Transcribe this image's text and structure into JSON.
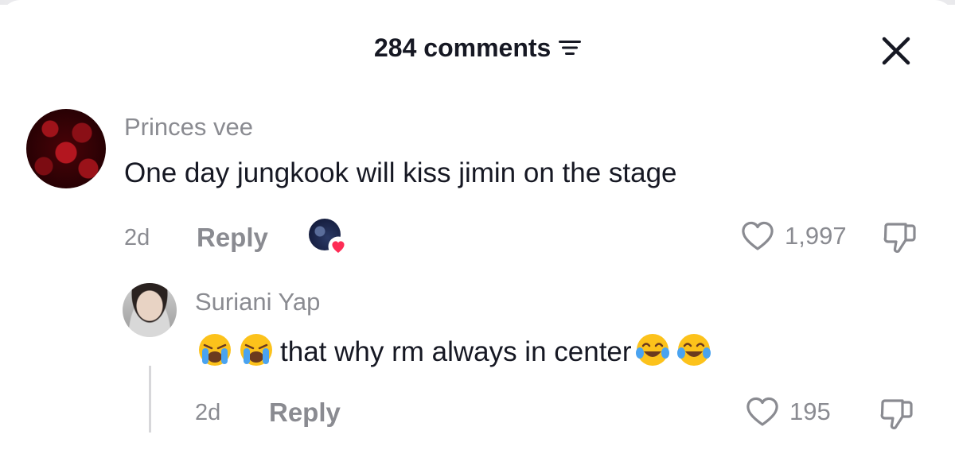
{
  "header": {
    "comment_count_label": "284 comments"
  },
  "comments": [
    {
      "username": "Princes vee",
      "text": "One day jungkook will kiss jimin on the stage",
      "age": "2d",
      "reply_label": "Reply",
      "like_count": "1,997",
      "creator_liked": true
    }
  ],
  "replies": [
    {
      "username": "Suriani Yap",
      "text": "that why rm always in center",
      "age": "2d",
      "reply_label": "Reply",
      "like_count": "195"
    }
  ],
  "icons": {
    "sort": "sort-lines-icon",
    "close": "close-icon",
    "like": "heart-outline-icon",
    "dislike": "thumbs-down-icon",
    "emoji_crying": "loudly-crying-face",
    "emoji_laughing": "tears-of-joy-face"
  },
  "colors": {
    "primary_text": "#161823",
    "secondary_text": "#8a8b91",
    "heart_badge": "#fe2c55"
  }
}
